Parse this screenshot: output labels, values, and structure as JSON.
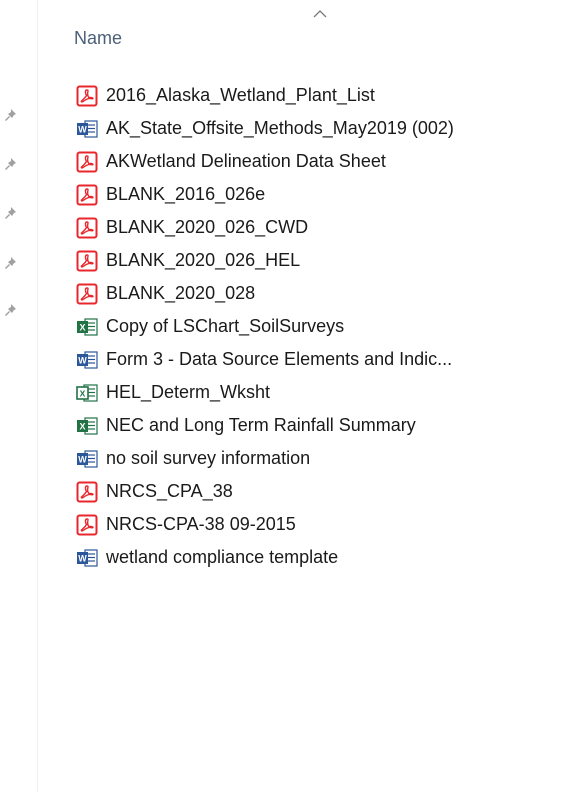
{
  "header": {
    "name_label": "Name"
  },
  "colors": {
    "pdf": "#e8262b",
    "word": "#2b579a",
    "excel": "#217346",
    "header_text": "#4c607a",
    "pin": "#a0a0a0"
  },
  "quick_access_pins": [
    {
      "icon": "pin-icon"
    },
    {
      "icon": "pin-icon"
    },
    {
      "icon": "pin-icon"
    },
    {
      "icon": "pin-icon"
    },
    {
      "icon": "pin-icon"
    }
  ],
  "files": [
    {
      "name": "2016_Alaska_Wetland_Plant_List",
      "type": "pdf",
      "icon": "pdf-icon"
    },
    {
      "name": "AK_State_Offsite_Methods_May2019 (002)",
      "type": "word",
      "icon": "word-icon"
    },
    {
      "name": "AKWetland Delineation Data Sheet",
      "type": "pdf",
      "icon": "pdf-icon"
    },
    {
      "name": "BLANK_2016_026e",
      "type": "pdf",
      "icon": "pdf-icon"
    },
    {
      "name": "BLANK_2020_026_CWD",
      "type": "pdf",
      "icon": "pdf-icon"
    },
    {
      "name": "BLANK_2020_026_HEL",
      "type": "pdf",
      "icon": "pdf-icon"
    },
    {
      "name": "BLANK_2020_028",
      "type": "pdf",
      "icon": "pdf-icon"
    },
    {
      "name": "Copy of LSChart_SoilSurveys",
      "type": "excel",
      "icon": "excel-icon"
    },
    {
      "name": "Form 3 - Data Source Elements and Indic...",
      "type": "word",
      "icon": "word-icon"
    },
    {
      "name": "HEL_Determ_Wksht",
      "type": "excel-legacy",
      "icon": "excel-legacy-icon"
    },
    {
      "name": "NEC and Long Term Rainfall Summary",
      "type": "excel",
      "icon": "excel-icon"
    },
    {
      "name": "no soil survey information",
      "type": "word",
      "icon": "word-icon"
    },
    {
      "name": "NRCS_CPA_38",
      "type": "pdf",
      "icon": "pdf-icon"
    },
    {
      "name": "NRCS-CPA-38 09-2015",
      "type": "pdf",
      "icon": "pdf-icon"
    },
    {
      "name": "wetland compliance template",
      "type": "word",
      "icon": "word-icon"
    }
  ]
}
